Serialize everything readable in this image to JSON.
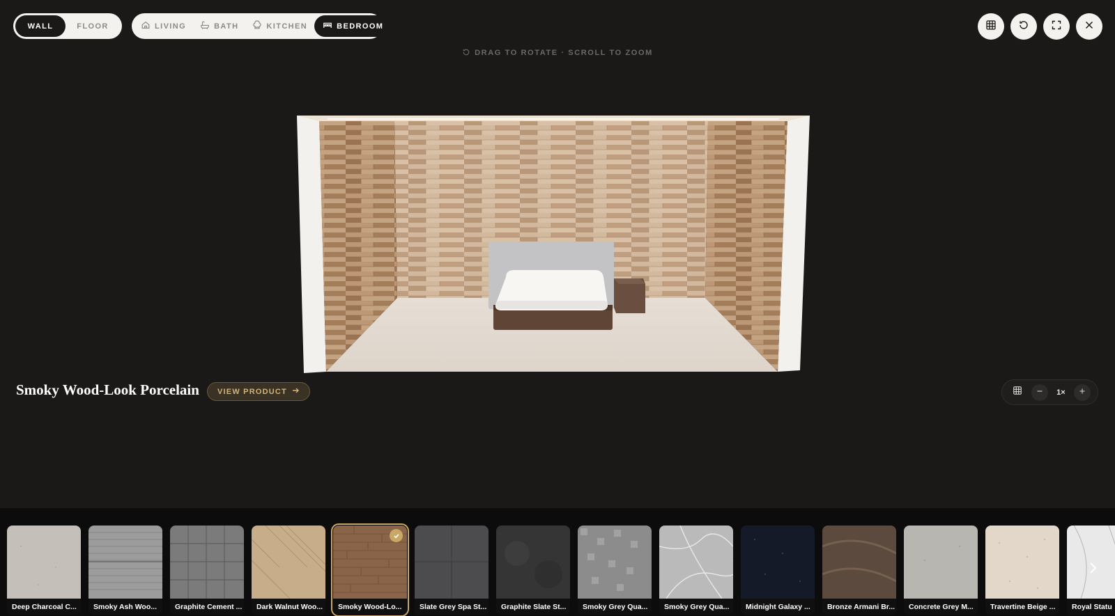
{
  "mode_toggle": {
    "wall_label": "WALL",
    "floor_label": "FLOOR",
    "active": "WALL"
  },
  "rooms": {
    "living_label": "LIVING",
    "bath_label": "BATH",
    "kitchen_label": "KITCHEN",
    "bedroom_label": "BEDROOM",
    "active": "BEDROOM"
  },
  "top_actions": [
    "grid-icon",
    "reset-icon",
    "fullscreen-icon",
    "close-icon"
  ],
  "hint": "DRAG TO ROTATE · SCROLL TO ZOOM",
  "product": {
    "title": "Smoky Wood-Look Porcelain",
    "view_label": "VIEW PRODUCT"
  },
  "zoom": {
    "level": "1×"
  },
  "colors": {
    "background": "#1a1918",
    "accent_gold": "#c9a866",
    "pill_bg": "#f4f2ef"
  },
  "swatches": [
    {
      "label": "Deep Charcoal C...",
      "tex": "concrete-light"
    },
    {
      "label": "Smoky Ash Woo...",
      "tex": "ash-wood"
    },
    {
      "label": "Graphite Cement ...",
      "tex": "graphite-tiles"
    },
    {
      "label": "Dark Walnut Woo...",
      "tex": "walnut-parquet"
    },
    {
      "label": "Smoky Wood-Lo...",
      "tex": "smoky-wood",
      "selected": true
    },
    {
      "label": "Slate Grey Spa St...",
      "tex": "slate-grey"
    },
    {
      "label": "Graphite Slate St...",
      "tex": "graphite-slate"
    },
    {
      "label": "Smoky Grey Qua...",
      "tex": "grey-mosaic"
    },
    {
      "label": "Smoky Grey Qua...",
      "tex": "grey-marble"
    },
    {
      "label": "Midnight Galaxy ...",
      "tex": "midnight-galaxy"
    },
    {
      "label": "Bronze Armani Br...",
      "tex": "bronze-armani"
    },
    {
      "label": "Concrete Grey M...",
      "tex": "concrete-grey"
    },
    {
      "label": "Travertine Beige ...",
      "tex": "travertine"
    },
    {
      "label": "Royal Statu",
      "tex": "statuario"
    }
  ]
}
